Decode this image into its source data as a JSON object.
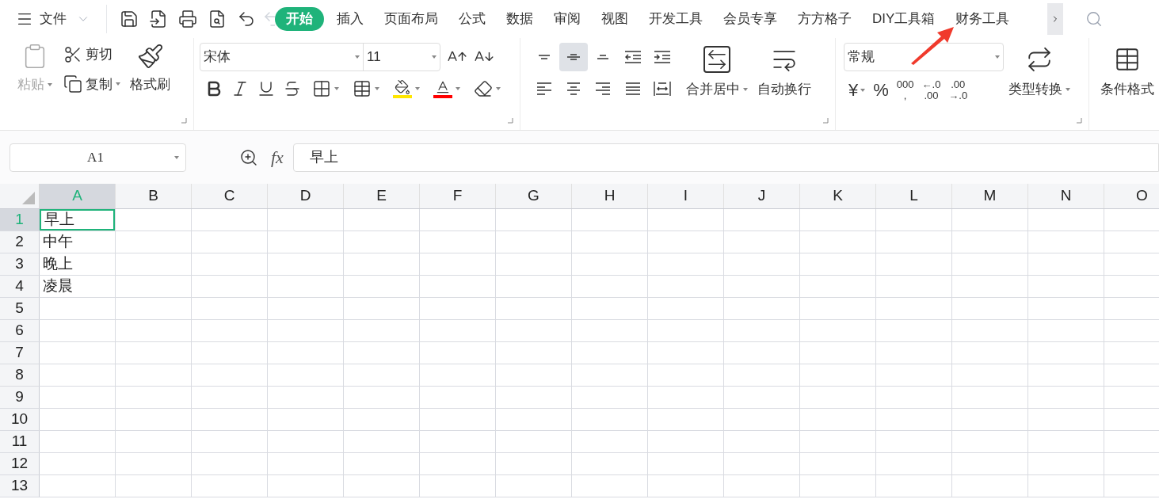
{
  "menu": {
    "label": "文件"
  },
  "ribbon_tabs": [
    {
      "label": "开始",
      "selected": true
    },
    {
      "label": "插入",
      "selected": false
    },
    {
      "label": "页面布局",
      "selected": false
    },
    {
      "label": "公式",
      "selected": false
    },
    {
      "label": "数据",
      "selected": false
    },
    {
      "label": "审阅",
      "selected": false
    },
    {
      "label": "视图",
      "selected": false
    },
    {
      "label": "开发工具",
      "selected": false
    },
    {
      "label": "会员专享",
      "selected": false
    },
    {
      "label": "方方格子",
      "selected": false
    },
    {
      "label": "DIY工具箱",
      "selected": false
    },
    {
      "label": "财务工具",
      "selected": false
    }
  ],
  "clipboard": {
    "paste": {
      "label": "粘贴",
      "disabled": true
    },
    "cut": "剪切",
    "copy": "复制",
    "format_painter": "格式刷"
  },
  "font": {
    "name": "宋体",
    "size": "11"
  },
  "alignment": {
    "buttons": [
      {
        "kind": "top",
        "selected": false
      },
      {
        "kind": "middle",
        "selected": true
      },
      {
        "kind": "bottom",
        "selected": false
      },
      {
        "kind": "outdent",
        "selected": false
      },
      {
        "kind": "indent",
        "selected": false
      },
      {
        "kind": "left",
        "selected": false
      },
      {
        "kind": "center",
        "selected": false
      },
      {
        "kind": "right",
        "selected": false
      },
      {
        "kind": "justify",
        "selected": false
      },
      {
        "kind": "distributed",
        "selected": false
      }
    ],
    "merge": "合并居中",
    "wrap": "自动换行"
  },
  "number": {
    "format": "常规",
    "buttons": [
      {
        "lines": [
          "¥"
        ],
        "dropdown": true
      },
      {
        "lines": [
          "%"
        ],
        "dropdown": false
      },
      {
        "lines": [
          "000",
          ","
        ],
        "dropdown": false
      },
      {
        "lines": [
          "←.0",
          ".00"
        ],
        "dropdown": false
      },
      {
        "lines": [
          ".00",
          "→.0"
        ],
        "dropdown": false
      }
    ],
    "convert": "类型转换"
  },
  "conditional_format": "条件格式",
  "formula_bar": {
    "cell": "A1",
    "fx": "fx",
    "value": "早上"
  },
  "sheet": {
    "columns": [
      {
        "label": "A",
        "selected": true
      },
      {
        "label": "B",
        "selected": false
      },
      {
        "label": "C",
        "selected": false
      },
      {
        "label": "D",
        "selected": false
      },
      {
        "label": "E",
        "selected": false
      },
      {
        "label": "F",
        "selected": false
      },
      {
        "label": "G",
        "selected": false
      },
      {
        "label": "H",
        "selected": false
      },
      {
        "label": "I",
        "selected": false
      },
      {
        "label": "J",
        "selected": false
      },
      {
        "label": "K",
        "selected": false
      },
      {
        "label": "L",
        "selected": false
      },
      {
        "label": "M",
        "selected": false
      },
      {
        "label": "N",
        "selected": false
      },
      {
        "label": "O",
        "selected": false
      }
    ],
    "rows": [
      {
        "label": "1",
        "selected": true,
        "cells": [
          "早上"
        ]
      },
      {
        "label": "2",
        "selected": false,
        "cells": [
          "中午"
        ]
      },
      {
        "label": "3",
        "selected": false,
        "cells": [
          "晚上"
        ]
      },
      {
        "label": "4",
        "selected": false,
        "cells": [
          "凌晨"
        ]
      },
      {
        "label": "5",
        "selected": false,
        "cells": []
      },
      {
        "label": "6",
        "selected": false,
        "cells": []
      },
      {
        "label": "7",
        "selected": false,
        "cells": []
      },
      {
        "label": "8",
        "selected": false,
        "cells": []
      },
      {
        "label": "9",
        "selected": false,
        "cells": []
      },
      {
        "label": "10",
        "selected": false,
        "cells": []
      },
      {
        "label": "11",
        "selected": false,
        "cells": []
      },
      {
        "label": "12",
        "selected": false,
        "cells": []
      },
      {
        "label": "13",
        "selected": false,
        "cells": []
      }
    ]
  }
}
